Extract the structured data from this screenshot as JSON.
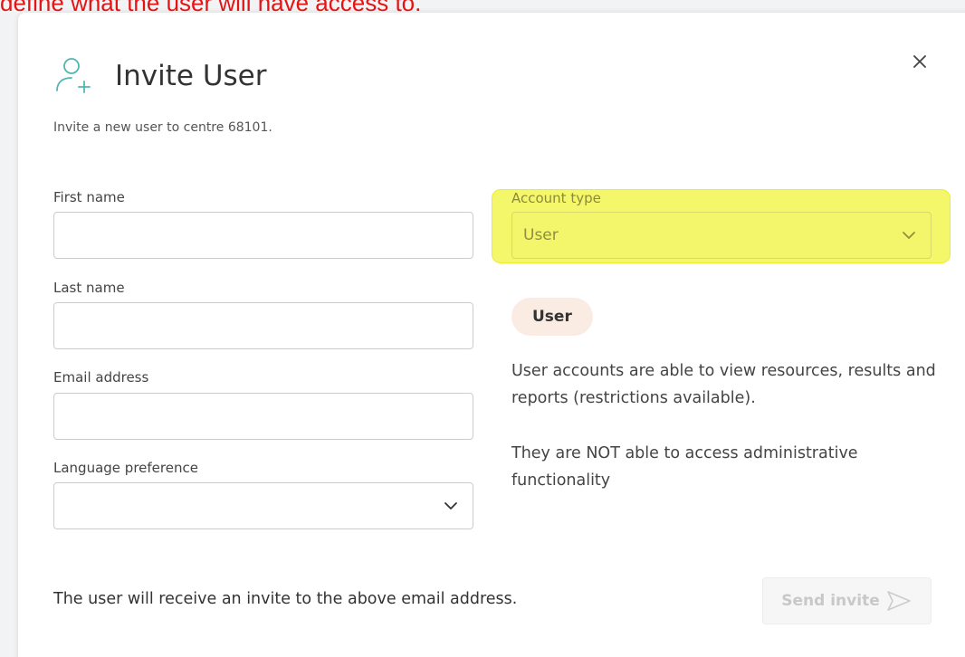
{
  "annotation_text": "define what the user will have access to.",
  "modal": {
    "title": "Invite User",
    "subtitle": "Invite a new user to centre 68101.",
    "close_icon": "close-icon",
    "title_icon": "add-user-icon"
  },
  "form": {
    "first_name_label": "First name",
    "first_name_value": "",
    "last_name_label": "Last name",
    "last_name_value": "",
    "email_label": "Email address",
    "email_value": "",
    "language_label": "Language preference",
    "language_value": "",
    "account_type_label": "Account type",
    "account_type_value": "User"
  },
  "account_info": {
    "badge": "User",
    "description_1": "User accounts are able to view resources, results and reports (restrictions available).",
    "description_2": "They are NOT able to access administrative functionality"
  },
  "footer": {
    "note": "The user will receive an invite to the above email address.",
    "send_label": "Send invite",
    "send_icon": "send-arrow-icon"
  },
  "colors": {
    "annotation": "#e51414",
    "highlight": "#f5f76a",
    "badge_bg": "#fbece3",
    "disabled_text": "#c8c8c8"
  }
}
